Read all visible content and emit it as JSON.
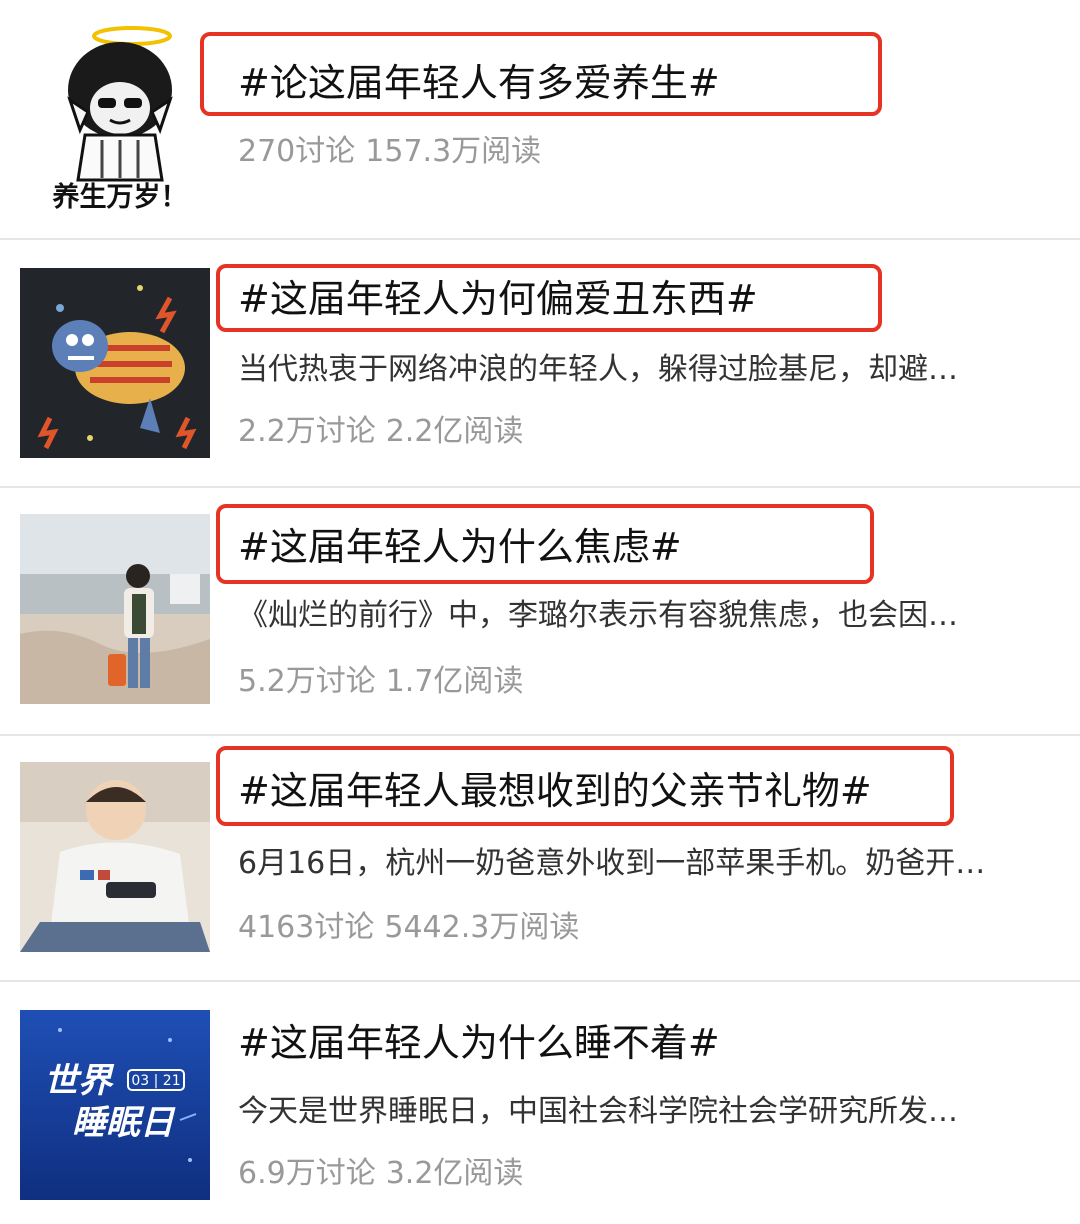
{
  "topics": [
    {
      "title": "#论这届年轻人有多爱养生#",
      "description": "",
      "discussions": "270讨论",
      "reads": "157.3万阅读",
      "thumb_caption": "养生万岁！",
      "highlighted": true
    },
    {
      "title": "#这届年轻人为何偏爱丑东西#",
      "description": "当代热衷于网络冲浪的年轻人，躲得过脸基尼，却避…",
      "discussions": "2.2万讨论",
      "reads": "2.2亿阅读",
      "highlighted": true
    },
    {
      "title": "#这届年轻人为什么焦虑#",
      "description": "《灿烂的前行》中，李璐尔表示有容貌焦虑，也会因…",
      "discussions": "5.2万讨论",
      "reads": "1.7亿阅读",
      "highlighted": true
    },
    {
      "title": "#这届年轻人最想收到的父亲节礼物#",
      "description": "6月16日，杭州一奶爸意外收到一部苹果手机。奶爸开…",
      "discussions": "4163讨论",
      "reads": "5442.3万阅读",
      "highlighted": true
    },
    {
      "title": "#这届年轻人为什么睡不着#",
      "description": "今天是世界睡眠日，中国社会科学院社会学研究所发…",
      "discussions": "6.9万讨论",
      "reads": "3.2亿阅读",
      "thumb_caption_line1": "世界",
      "thumb_caption_line2": "睡眠日",
      "thumb_date": "03 | 21",
      "highlighted": false
    }
  ],
  "colors": {
    "highlight_border": "#e53324",
    "stats_text": "#999999",
    "divider": "#e6e6e6"
  }
}
